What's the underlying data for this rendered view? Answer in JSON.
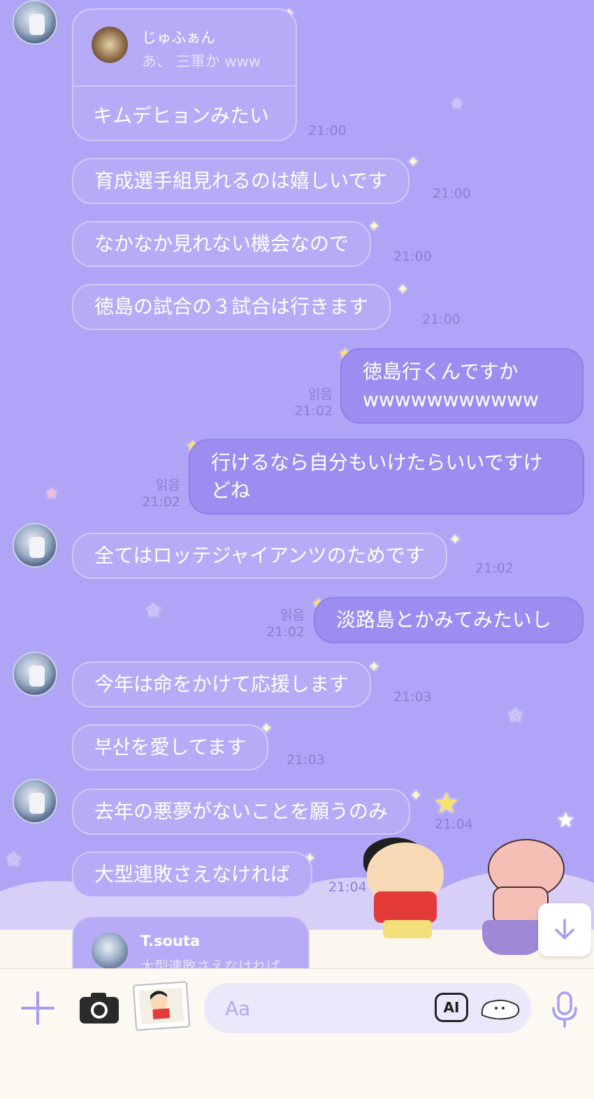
{
  "quote": {
    "name": "じゅふぁん",
    "text": "あ、 三軍か www",
    "reply": "キムデヒョンみたい",
    "time": "21:00"
  },
  "messages": [
    {
      "text": "育成選手組見れるのは嬉しいです",
      "time": "21:00"
    },
    {
      "text": "なかなか見れない機会なので",
      "time": "21:00"
    },
    {
      "text": "徳島の試合の３試合は行きます",
      "time": "21:00"
    },
    {
      "line1": "徳島行くんですか",
      "line2": "wwwwwwwwwww",
      "read": "읽음",
      "time": "21:02"
    },
    {
      "line1": "行けるなら自分もいけたらいいですけ",
      "line2": "どね",
      "read": "읽음",
      "time": "21:02"
    },
    {
      "text": "全てはロッテジャイアンツのためです",
      "time": "21:02"
    },
    {
      "text": "淡路島とかみてみたいし",
      "read": "읽음",
      "time": "21:02"
    },
    {
      "text": "今年は命をかけて応援します",
      "time": "21:03"
    },
    {
      "text": "부산を愛してます",
      "time": "21:03"
    },
    {
      "text": "去年の悪夢がないことを願うのみ",
      "time": "21:04"
    },
    {
      "text": "大型連敗さえなければ",
      "time": "21:04"
    }
  ],
  "reply_preview": {
    "name": "T.souta",
    "text": "大型連敗さえなければ"
  },
  "input": {
    "placeholder": "Aa",
    "ai_label": "AI"
  },
  "colors": {
    "background": "#b0a4f6",
    "received_bubble": "#b7aaf7",
    "sent_bubble": "#9d8df1",
    "accent": "#a89cf0"
  }
}
